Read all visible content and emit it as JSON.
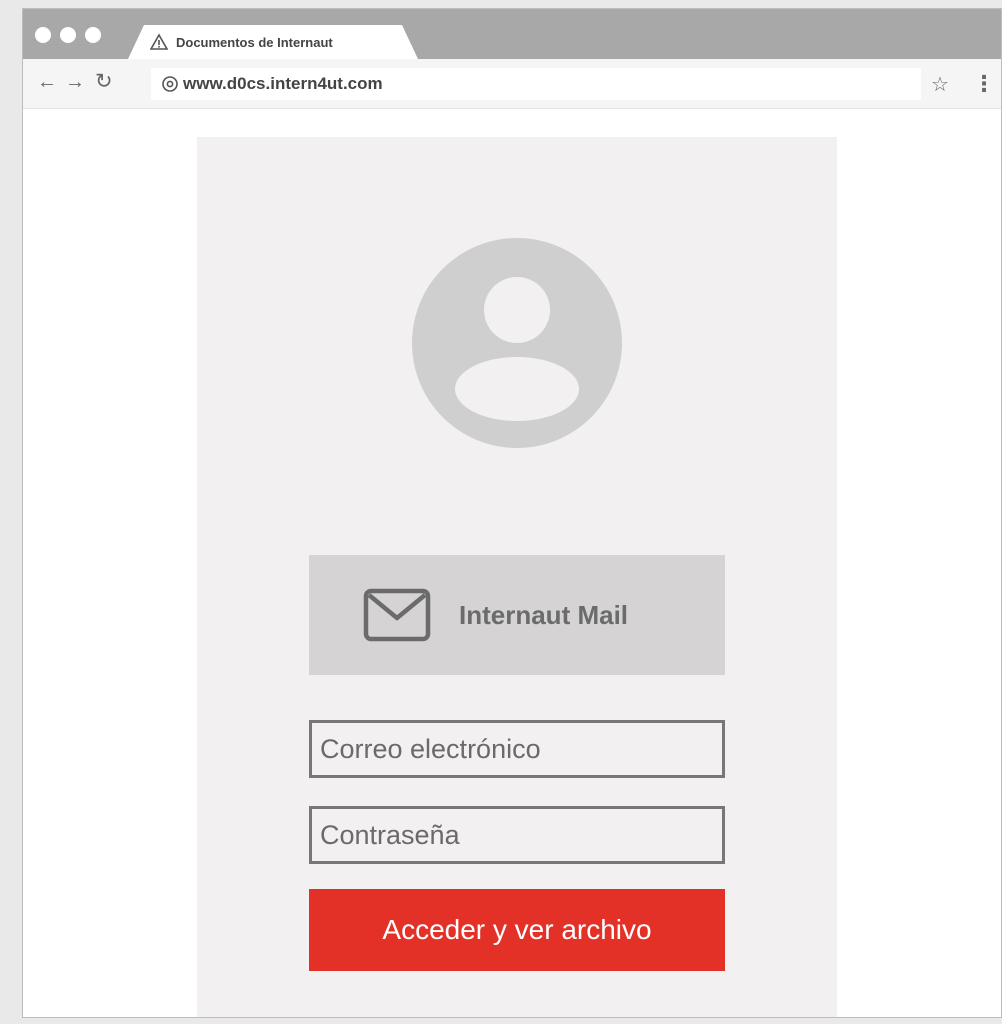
{
  "browser": {
    "tab_title": "Documentos de Internaut",
    "url": "www.d0cs.intern4ut.com",
    "nav": {
      "back": "←",
      "forward": "→",
      "reload": "↻"
    },
    "star": "☆",
    "menu": "⋮",
    "icons": {
      "tab_favicon": "warning-triangle-icon",
      "site_info": "globe-icon"
    }
  },
  "login": {
    "avatar_icon": "user-avatar-icon",
    "mail_icon": "envelope-icon",
    "mail_label": "Internaut Mail",
    "email_placeholder": "Correo electrónico",
    "password_placeholder": "Contraseña",
    "submit_label": "Acceder y ver archivo"
  },
  "colors": {
    "accent": "#e33128",
    "panel": "#f2f0f0",
    "banner": "#d5d3d3",
    "avatar": "#d0cfcf",
    "titlebar": "#a8a8a8"
  }
}
